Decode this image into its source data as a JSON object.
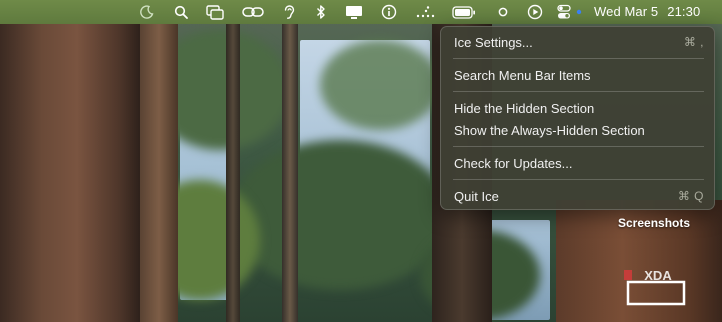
{
  "menubar": {
    "icons": [
      "moon-icon",
      "search-icon",
      "window-stack-icon",
      "link-icon",
      "ear-icon",
      "bluetooth-icon",
      "display-icon",
      "info-icon",
      "ice-dots-icon",
      "battery-icon",
      "circle-icon",
      "play-icon",
      "control-center-icon",
      "dot-icon"
    ],
    "date": "Wed Mar 5",
    "time": "21:30"
  },
  "menu": {
    "items": [
      {
        "label": "Ice Settings...",
        "shortcut": "⌘ ,"
      },
      {
        "label": "Search Menu Bar Items",
        "shortcut": ""
      },
      {
        "label": "Hide the Hidden Section",
        "shortcut": ""
      },
      {
        "label": "Show the Always-Hidden Section",
        "shortcut": ""
      },
      {
        "label": "Check for Updates...",
        "shortcut": ""
      },
      {
        "label": "Quit Ice",
        "shortcut": "⌘ Q"
      }
    ]
  },
  "watermark": {
    "caption": "Screenshots",
    "logo": "XDA"
  },
  "colors": {
    "menubar": "#6a8543",
    "menu_bg": "#3e4034",
    "accent_dot": "#3b82f6"
  }
}
